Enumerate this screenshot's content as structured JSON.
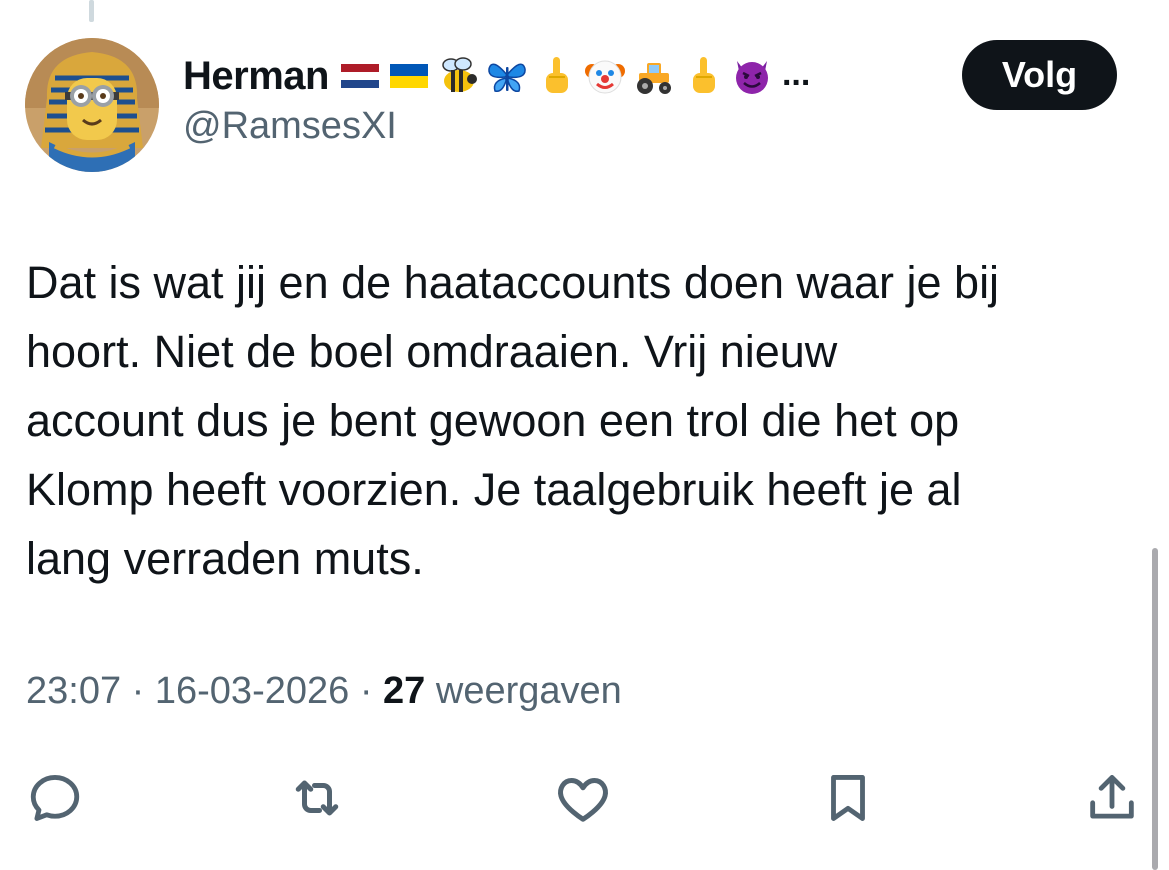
{
  "author": {
    "display_name": "Herman",
    "handle": "@RamsesXI",
    "name_emojis": [
      "netherlands-flag",
      "ukraine-flag",
      "bee",
      "butterfly",
      "middle-finger",
      "clown-face",
      "tractor",
      "middle-finger",
      "smiling-devil"
    ],
    "name_overflow": "..."
  },
  "follow_button": {
    "label": "Volg"
  },
  "tweet": {
    "lines": [
      "Dat is wat jij en de haataccounts doen waar je bij",
      "hoort. Niet de boel omdraaien. Vrij nieuw",
      "account dus je bent gewoon een trol die het op",
      "Klomp heeft voorzien. Je taalgebruik heeft je al",
      "lang verraden muts."
    ]
  },
  "meta": {
    "time": "23:07",
    "separator": "·",
    "date": "16-03-2026",
    "views_count": "27",
    "views_label": "weergaven"
  },
  "actions": [
    "reply-icon",
    "retweet-icon",
    "like-icon",
    "bookmark-icon",
    "share-icon"
  ],
  "colors": {
    "text_primary": "#0f1419",
    "text_secondary": "#536471",
    "follow_bg": "#0f1419",
    "follow_text": "#ffffff",
    "background": "#ffffff"
  }
}
